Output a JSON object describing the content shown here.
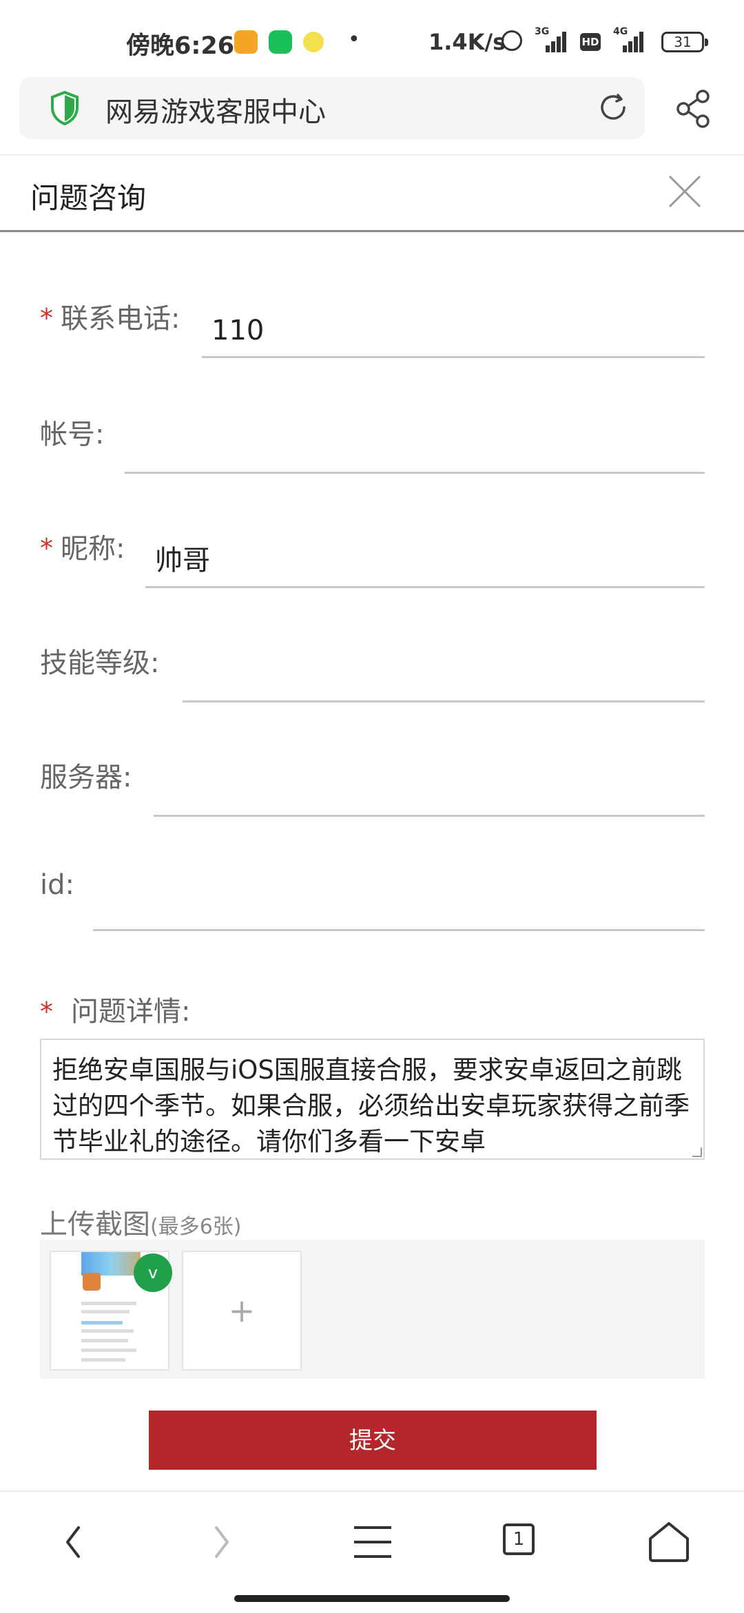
{
  "status_bar": {
    "time": "傍晚6:26",
    "net_speed": "1.4K/s",
    "net_3g": "3G",
    "net_4g": "4G",
    "hd": "HD",
    "battery": "31"
  },
  "browser": {
    "site_title": "网易游戏客服中心"
  },
  "page": {
    "title": "问题咨询"
  },
  "form": {
    "required_mark": "*",
    "phone": {
      "label": "联系电话:",
      "value": "110"
    },
    "account": {
      "label": "帐号:",
      "value": ""
    },
    "nickname": {
      "label": "昵称:",
      "value": "帅哥"
    },
    "skill_level": {
      "label": "技能等级:",
      "value": ""
    },
    "server": {
      "label": "服务器:",
      "value": ""
    },
    "id": {
      "label": "id:",
      "value": ""
    },
    "detail": {
      "label": "问题详情:",
      "value": "拒绝安卓国服与iOS国服直接合服，要求安卓返回之前跳过的四个季节。如果合服，必须给出安卓玩家获得之前季节毕业礼的途径。请你们多看一下安卓"
    },
    "upload": {
      "label": "上传截图",
      "hint": "(最多6张)",
      "add_symbol": "+",
      "badge": "v"
    },
    "submit_label": "提交"
  },
  "bottom_nav": {
    "tab_count": "1"
  }
}
